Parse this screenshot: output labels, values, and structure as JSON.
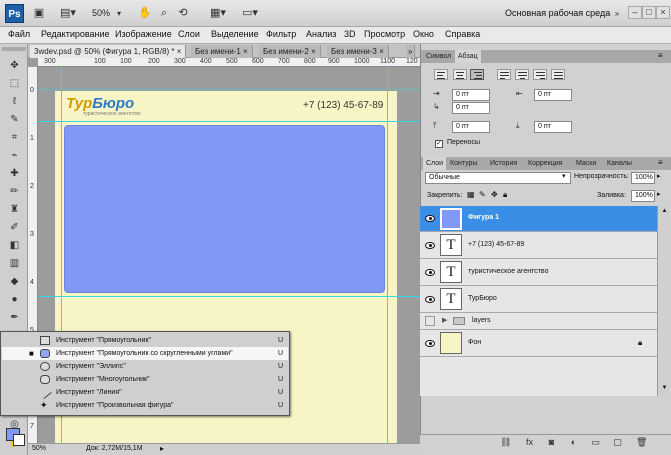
{
  "app": {
    "logo": "Ps",
    "zoom": "50%",
    "workspace": "Основная рабочая среда",
    "window_buttons": [
      "–",
      "□",
      "×"
    ]
  },
  "menu": [
    "Файл",
    "Редактирование",
    "Изображение",
    "Слои",
    "Выделение",
    "Фильтр",
    "Анализ",
    "3D",
    "Просмотр",
    "Окно",
    "Справка"
  ],
  "doc_tabs": [
    "3wdev.psd @ 50% (Фигура 1, RGB/8) *",
    "Без имени-1",
    "Без имени-2",
    "Без имени-3"
  ],
  "tab_close": "×",
  "tabs_overflow": "»",
  "ruler": {
    "h": [
      "300",
      "100",
      "100",
      "200",
      "300",
      "400",
      "500",
      "600",
      "700",
      "800",
      "900",
      "1000",
      "1100",
      "120"
    ],
    "v": [
      "0",
      "1",
      "2",
      "3",
      "4",
      "5",
      "6",
      "7"
    ]
  },
  "canvas": {
    "logo_a": "Тур",
    "logo_b": "Бюро",
    "logo_sub": "туристическое агентство",
    "phone": "+7 (123) 45-67-89"
  },
  "status": {
    "zoom": "50%",
    "doc": "Док: 2,72M/15,1M"
  },
  "flyout": [
    {
      "label": "Инструмент \"Прямоугольник\"",
      "key": "U"
    },
    {
      "label": "Инструмент \"Прямоугольник со скругленными углами\"",
      "key": "U"
    },
    {
      "label": "Инструмент \"Эллипс\"",
      "key": "U"
    },
    {
      "label": "Инструмент \"Многоугольник\"",
      "key": "U"
    },
    {
      "label": "Инструмент \"Линия\"",
      "key": "U"
    },
    {
      "label": "Инструмент \"Произвольная фигура\"",
      "key": "U"
    }
  ],
  "flyout_bullet": "■",
  "paragraph": {
    "tabs": [
      "Символ",
      "Абзац"
    ],
    "fields": [
      "0 пт",
      "0 пт",
      "0 пт",
      "0 пт",
      "0 пт"
    ],
    "hyphen_label": "Переносы"
  },
  "layers_panel": {
    "tabs": [
      "Слои",
      "Контуры",
      "История",
      "Коррекция",
      "Маски",
      "Каналы"
    ],
    "blend_mode": "Обычные",
    "opacity_label": "Непрозрачность:",
    "opacity": "100%",
    "lock_label": "Закрепить:",
    "fill_label": "Заливка:",
    "fill": "100%",
    "items": [
      {
        "name": "Фигура 1",
        "thumb": "",
        "selected": true
      },
      {
        "name": "+7 (123) 45-67-89",
        "thumb": "T",
        "selected": false
      },
      {
        "name": "туристическое агентство",
        "thumb": "T",
        "selected": false
      },
      {
        "name": "ТурБюро",
        "thumb": "T",
        "selected": false
      },
      {
        "name": "layers",
        "thumb": "",
        "selected": false
      },
      {
        "name": "Фон",
        "thumb": "",
        "selected": false
      }
    ]
  },
  "colors": {
    "accent": "#3a8ee6",
    "shape": "#7f99f5",
    "doc_bg": "#f7f5c5"
  }
}
